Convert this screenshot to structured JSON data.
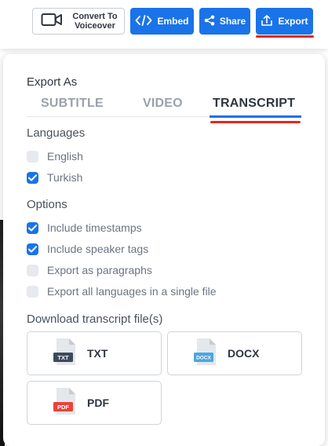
{
  "toolbar": {
    "convert_label": "Convert To\nVoiceover",
    "embed_label": "Embed",
    "share_label": "Share",
    "export_label": "Export"
  },
  "panel": {
    "export_as": "Export As",
    "tabs": [
      {
        "label": "SUBTITLE",
        "active": false
      },
      {
        "label": "VIDEO",
        "active": false
      },
      {
        "label": "TRANSCRIPT",
        "active": true
      }
    ],
    "languages_title": "Languages",
    "languages": [
      {
        "label": "English",
        "checked": false
      },
      {
        "label": "Turkish",
        "checked": true
      }
    ],
    "options_title": "Options",
    "options": [
      {
        "label": "Include timestamps",
        "checked": true
      },
      {
        "label": "Include speaker tags",
        "checked": true
      },
      {
        "label": "Export as paragraphs",
        "checked": false
      },
      {
        "label": "Export all languages in a single file",
        "checked": false
      }
    ],
    "download_title": "Download transcript file(s)",
    "files": [
      {
        "label": "TXT",
        "icon": "txt-file-icon",
        "tag": "TXT",
        "color": "#3d4a5c"
      },
      {
        "label": "DOCX",
        "icon": "docx-file-icon",
        "tag": "DOCX",
        "color": "#4aa8e0"
      },
      {
        "label": "PDF",
        "icon": "pdf-file-icon",
        "tag": "PDF",
        "color": "#e8433a"
      }
    ]
  },
  "colors": {
    "accent": "#1a73e8",
    "highlight": "#e8261c"
  }
}
